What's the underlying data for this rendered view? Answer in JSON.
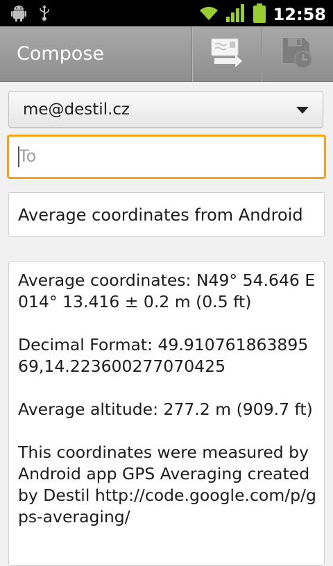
{
  "status_bar": {
    "time": "12:58",
    "icons": [
      "android-debug-icon",
      "usb-icon",
      "wifi-icon",
      "signal-icon",
      "battery-icon"
    ],
    "accent_color": "#9acd32"
  },
  "action_bar": {
    "title": "Compose",
    "send_icon": "send-message-icon",
    "save_icon": "save-draft-icon"
  },
  "compose": {
    "from": "me@destil.cz",
    "to_value": "",
    "to_placeholder": "To",
    "subject": "Average coordinates from Android",
    "body": [
      "Average coordinates: N49° 54.646 E014° 13.416 ± 0.2 m (0.5 ft)",
      "Decimal Format: 49.91076186389569,14.223600277070425",
      "Average altitude: 277.2 m (909.7 ft)",
      "This coordinates were measured by Android app GPS Averaging created by Destil http://code.google.com/p/gps-averaging/"
    ]
  },
  "colors": {
    "focus_border": "#f6a31c",
    "action_bar": "#9d9d9d",
    "background": "#f1f1f1"
  }
}
